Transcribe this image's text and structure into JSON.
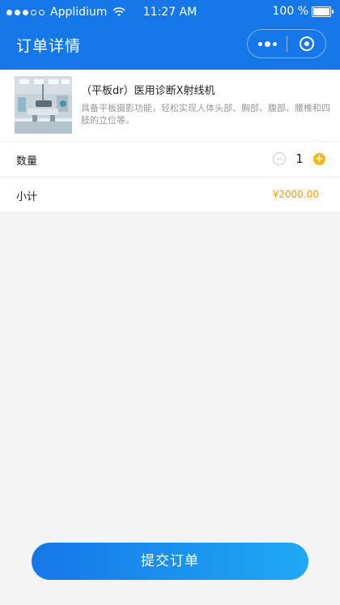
{
  "status_bar": {
    "carrier": "Applidium",
    "time": "11:27 AM",
    "battery": "100 %"
  },
  "header": {
    "title": "订单详情"
  },
  "product": {
    "name": "（平板dr）医用诊断X射线机",
    "description": "具备平板摄影功能，轻松实现人体头部、胸部、腹部、腰椎和四肢的立位等。"
  },
  "quantity": {
    "label": "数量",
    "minus": "−",
    "value": "1",
    "plus": "+"
  },
  "subtotal": {
    "label": "小计",
    "amount": "¥2000.00"
  },
  "submit_label": "提交订单",
  "colors": {
    "primary": "#1677e8",
    "accent": "#f5b512",
    "price": "#f39c12"
  }
}
